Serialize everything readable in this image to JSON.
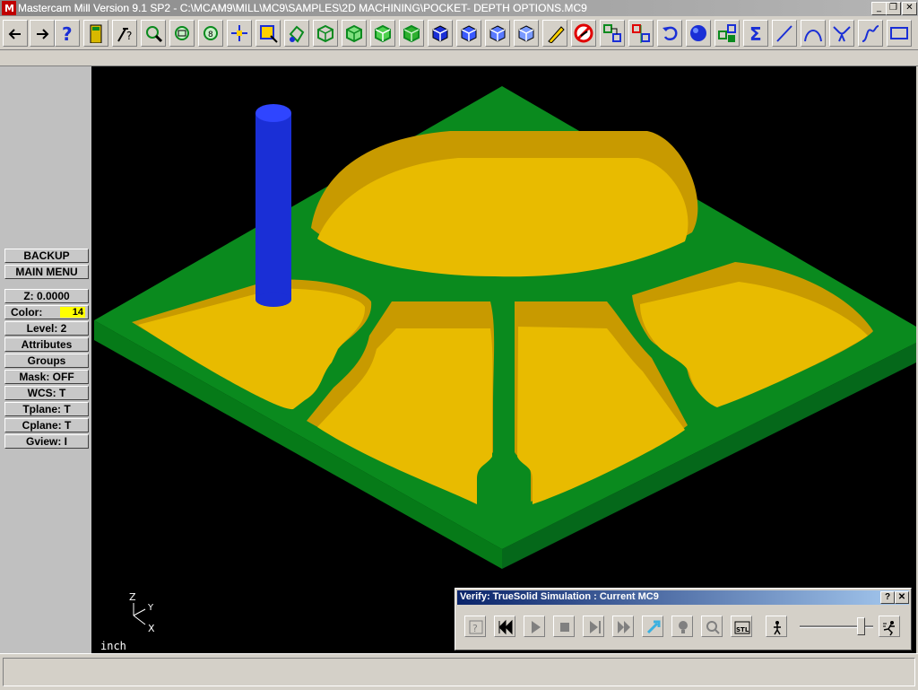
{
  "window": {
    "title": "Mastercam Mill Version 9.1 SP2 - C:\\MCAM9\\MILL\\MC9\\SAMPLES\\2D MACHINING\\POCKET- DEPTH OPTIONS.MC9",
    "minimize": "_",
    "restore": "❐",
    "close": "✕"
  },
  "toolbar": {
    "buttons": [
      {
        "icon": "arrow-left-icon"
      },
      {
        "icon": "arrow-right-icon"
      },
      {
        "icon": "help-icon"
      },
      {
        "icon": "calculator-icon"
      },
      {
        "icon": "analyze-help-icon"
      },
      {
        "icon": "zoom-icon"
      },
      {
        "icon": "unzoom-icon"
      },
      {
        "icon": "zoom-8-icon"
      },
      {
        "icon": "pan-icon"
      },
      {
        "icon": "zoom-window-icon"
      },
      {
        "icon": "dynamic-rotate-icon"
      },
      {
        "icon": "view-top-icon"
      },
      {
        "icon": "view-front-icon"
      },
      {
        "icon": "view-side-icon"
      },
      {
        "icon": "view-iso-icon"
      },
      {
        "icon": "cplane-top-icon"
      },
      {
        "icon": "cplane-front-icon"
      },
      {
        "icon": "cplane-side-icon"
      },
      {
        "icon": "cplane-3d-icon"
      },
      {
        "icon": "erase-pencil-icon"
      },
      {
        "icon": "delete-icon"
      },
      {
        "icon": "translate-icon"
      },
      {
        "icon": "mirror-icon"
      },
      {
        "icon": "undo-icon"
      },
      {
        "icon": "shade-sphere-icon"
      },
      {
        "icon": "operations-manager-icon"
      },
      {
        "icon": "sigma-icon"
      },
      {
        "icon": "line-icon"
      },
      {
        "icon": "arc-icon"
      },
      {
        "icon": "fillet-icon"
      },
      {
        "icon": "spline-icon"
      },
      {
        "icon": "rectangle-icon"
      }
    ]
  },
  "menu": {
    "backup": "BACKUP",
    "main_menu": "MAIN MENU",
    "z": "Z:  0.0000",
    "color_label": "Color:",
    "color_value": "14",
    "level": "Level:  2",
    "attributes": "Attributes",
    "groups": "Groups",
    "mask": "Mask:  OFF",
    "wcs": "WCS:   T",
    "tplane": "Tplane:  T",
    "cplane": "Cplane:  T",
    "gview": "Gview:   I"
  },
  "viewport": {
    "unit": "inch",
    "axis_z": "Z",
    "axis_y": "Y",
    "axis_x": "X",
    "colors": {
      "stock": "#0a8a1e",
      "stock_side": "#067a18",
      "pocket": "#e8bb00",
      "wall": "#c89a00",
      "tool": "#1a2fd6"
    }
  },
  "verify": {
    "title": "Verify: TrueSolid Simulation : Current MC9",
    "help": "?",
    "close": "✕",
    "slider_position": 0.88,
    "buttons": [
      {
        "icon": "options-icon"
      },
      {
        "icon": "rewind-icon"
      },
      {
        "icon": "play-icon"
      },
      {
        "icon": "stop-icon"
      },
      {
        "icon": "step-icon"
      },
      {
        "icon": "fast-forward-icon"
      },
      {
        "icon": "tool-display-icon"
      },
      {
        "icon": "light-icon"
      },
      {
        "icon": "magnify-icon"
      },
      {
        "icon": "stl-save-icon"
      },
      {
        "icon": "speed-slow-icon"
      },
      {
        "icon": "speed-fast-icon"
      }
    ]
  }
}
